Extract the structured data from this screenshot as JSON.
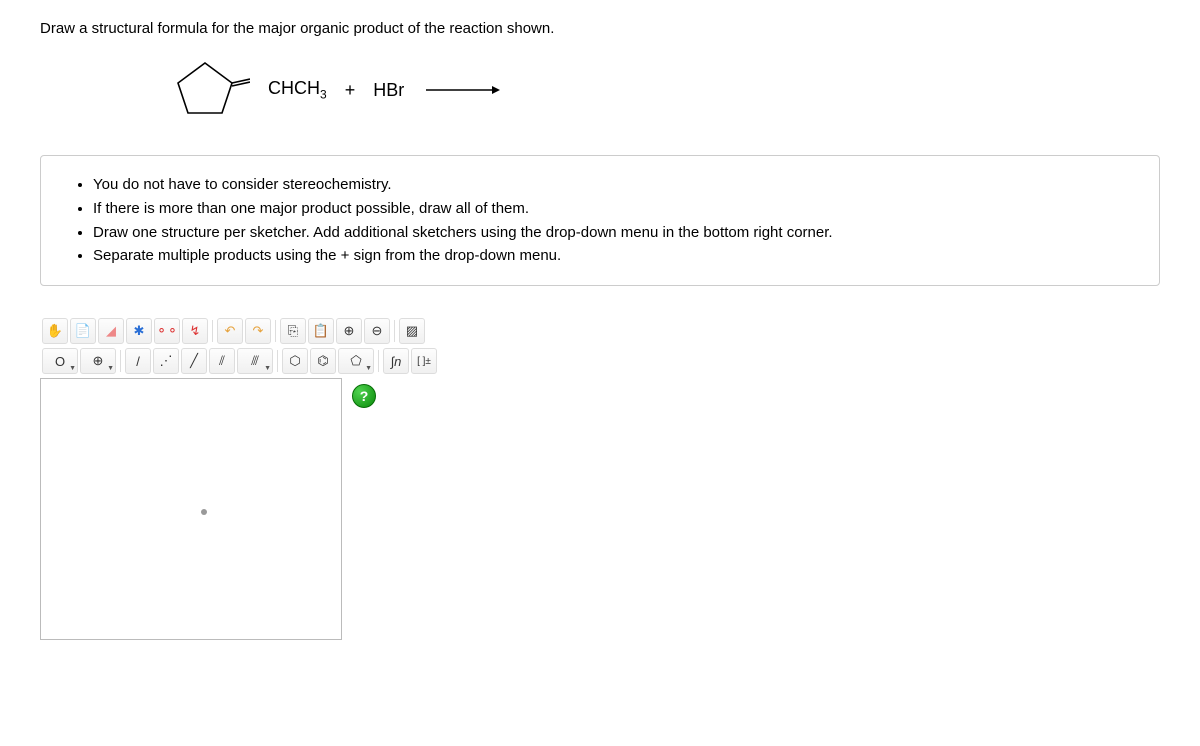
{
  "question": "Draw a structural formula for the major organic product of the reaction shown.",
  "reaction": {
    "reagent1_label": "CHCH",
    "reagent1_sub": "3",
    "plus": "+",
    "reagent2": "HBr"
  },
  "instructions": [
    "You do not have to consider stereochemistry.",
    "If there is more than one major product possible, draw all of them.",
    "Draw one structure per sketcher. Add additional sketchers using the drop-down menu in the bottom right corner.",
    "Separate multiple products using the + sign from the drop-down menu."
  ],
  "toolbar": {
    "hand": "✋",
    "open": "📄",
    "erase": "◢",
    "center": "✱",
    "clean": "⚬⚬",
    "optimize": "↯",
    "undo": "↶",
    "redo": "↷",
    "copy": "⎘",
    "paste": "📋",
    "zoomin": "⊕",
    "zoomout": "⊖",
    "color": "▨",
    "atom_label": "O",
    "charge_label": "⊕",
    "single": "/",
    "dashed": "⋰",
    "bold": "╱",
    "double": "⫽",
    "triple": "⫻",
    "hexagon": "⬡",
    "benzene": "⌬",
    "pentagon": "⬠",
    "chain": "∫n",
    "bracket": "[ ]±"
  },
  "help": "?"
}
